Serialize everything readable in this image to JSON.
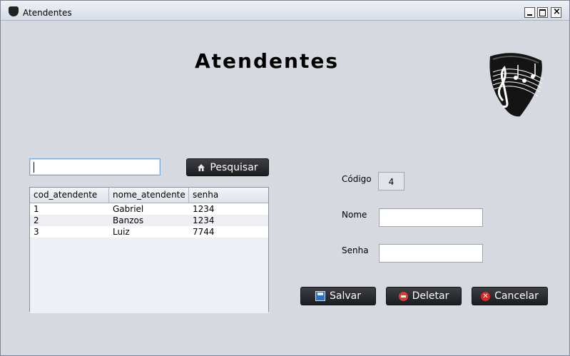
{
  "window": {
    "title": "Atendentes",
    "close_glyph": "×"
  },
  "header": {
    "title": "Atendentes"
  },
  "search": {
    "value": "",
    "button_label": "Pesquisar"
  },
  "table": {
    "columns": [
      "cod_atendente",
      "nome_atendente",
      "senha"
    ],
    "rows": [
      [
        "1",
        "Gabriel",
        "1234"
      ],
      [
        "2",
        "Banzos",
        "1234"
      ],
      [
        "3",
        "Luiz",
        "7744"
      ]
    ]
  },
  "form": {
    "codigo_label": "Código",
    "codigo_value": "4",
    "nome_label": "Nome",
    "nome_value": "",
    "senha_label": "Senha",
    "senha_value": ""
  },
  "actions": {
    "salvar": "Salvar",
    "deletar": "Deletar",
    "cancelar": "Cancelar",
    "cancel_glyph": "✕"
  }
}
